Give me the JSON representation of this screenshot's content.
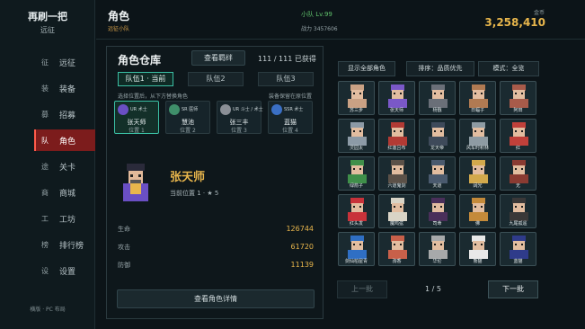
{
  "brand": {
    "title": "再刷一把",
    "subtitle": "远征"
  },
  "sidebar": {
    "items": [
      {
        "icon": "征",
        "label": "远征",
        "active": false
      },
      {
        "icon": "装",
        "label": "装备",
        "active": false
      },
      {
        "icon": "募",
        "label": "招募",
        "active": false
      },
      {
        "icon": "队",
        "label": "角色",
        "active": true
      },
      {
        "icon": "途",
        "label": "关卡",
        "active": false
      },
      {
        "icon": "商",
        "label": "商城",
        "active": false
      },
      {
        "icon": "工",
        "label": "工坊",
        "active": false
      },
      {
        "icon": "榜",
        "label": "排行榜",
        "active": false
      },
      {
        "icon": "设",
        "label": "设置",
        "active": false
      }
    ],
    "footer": "横版 · PC 布局"
  },
  "header": {
    "title": "角色",
    "team_name": "远征小队",
    "team_level": "小队 Lv.99",
    "power": "战力 3457606",
    "gold_label": "金币",
    "gold_value": "3,258,410"
  },
  "warehouse": {
    "title": "角色仓库",
    "bond_button": "查看羁绊",
    "owned_count": "111 / 111 已获得",
    "tabs": [
      "队伍1 · 当前",
      "队伍2",
      "队伍3"
    ],
    "hint_left": "选择位置后，从下方替换角色",
    "hint_right": "装备保留在原位置",
    "slots": [
      {
        "rarity": "UR 术士",
        "name": "张天师",
        "position": "位置 1",
        "color": "#6a4fc4"
      },
      {
        "rarity": "SR 医师",
        "name": "慧池",
        "position": "位置 2",
        "color": "#3f8f6a"
      },
      {
        "rarity": "UR 斗士 / 术士",
        "name": "张三丰",
        "position": "位置 3",
        "color": "#8a8f96"
      },
      {
        "rarity": "SSR 术士",
        "name": "蓝猫",
        "position": "位置 4",
        "color": "#3a6fc4"
      }
    ]
  },
  "detail": {
    "name": "张天师",
    "subtitle": "当前位置 1 · ★ 5",
    "stats": [
      {
        "label": "生命",
        "value": "126744"
      },
      {
        "label": "攻击",
        "value": "61720"
      },
      {
        "label": "防御",
        "value": "11139"
      }
    ],
    "detail_button": "查看角色详情"
  },
  "filters": {
    "show_all": "显示全部角色",
    "sort": "排序：品质优先",
    "mode": "模式：全览"
  },
  "roster": [
    {
      "name": "苏三步",
      "color": "#c9a184"
    },
    {
      "name": "张天师",
      "color": "#7a58c8"
    },
    {
      "name": "杨戬",
      "color": "#6a6f78"
    },
    {
      "name": "日蝠子",
      "color": "#b07a52"
    },
    {
      "name": "阿田",
      "color": "#a85b4a"
    },
    {
      "name": "灵园太",
      "color": "#8c9aa6"
    },
    {
      "name": "红莲吕布",
      "color": "#b23a34"
    },
    {
      "name": "龙天帝",
      "color": "#3e4a5a"
    },
    {
      "name": "风车时积林",
      "color": "#8e9ba3"
    },
    {
      "name": "红",
      "color": "#c0403a"
    },
    {
      "name": "绿箭子",
      "color": "#3f8f4a"
    },
    {
      "name": "六道鬼剑",
      "color": "#5b5148"
    },
    {
      "name": "天道",
      "color": "#4a5a6e"
    },
    {
      "name": "阔光",
      "color": "#d2a94c"
    },
    {
      "name": "无",
      "color": "#8a3b32"
    },
    {
      "name": "红头发",
      "color": "#c8323a"
    },
    {
      "name": "魔鸡弦",
      "color": "#d9d4c6"
    },
    {
      "name": "司命",
      "color": "#4a2f5a"
    },
    {
      "name": "佛",
      "color": "#c48a3a"
    },
    {
      "name": "九尾孤遥",
      "color": "#3a3838"
    },
    {
      "name": "剑仙柏屋青",
      "color": "#2f6fc4"
    },
    {
      "name": "驹香",
      "color": "#c8604a"
    },
    {
      "name": "华伦",
      "color": "#a7a9aa"
    },
    {
      "name": "熊猫",
      "color": "#e8e8e8"
    },
    {
      "name": "蓝猫",
      "color": "#2f3b8a"
    }
  ],
  "pager": {
    "prev": "上一批",
    "text": "1 / 5",
    "next": "下一批"
  }
}
